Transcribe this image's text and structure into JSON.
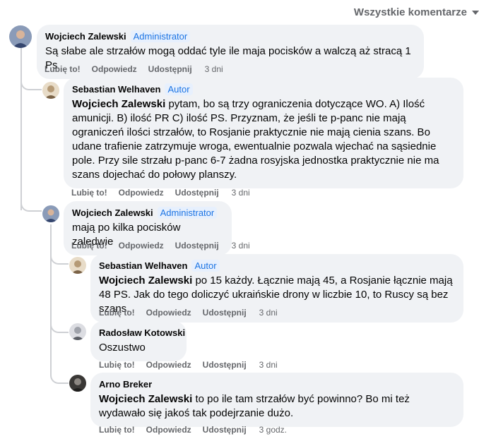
{
  "sort": {
    "label": "Wszystkie komentarze",
    "icon": "caret-down-icon"
  },
  "actions": {
    "like": "Lubię to!",
    "reply": "Odpowiedz",
    "share": "Udostępnij"
  },
  "comments": [
    {
      "author": "Wojciech Zalewski",
      "badge": "Administrator",
      "mention": "",
      "text": "Są słabe ale strzałów mogą oddać tyle ile maja pocisków a walczą aż stracą 1 Ps",
      "time": "3 dni"
    },
    {
      "author": "Sebastian Welhaven",
      "badge": "Autor",
      "mention": "Wojciech Zalewski",
      "text": " pytam, bo są trzy ograniczenia dotyczące WO. A) Ilość amunicji. B) ilość PR C) ilość PS. Przyznam, że jeśli te p-panc nie mają ograniczeń ilości strzałów, to Rosjanie praktycznie nie mają cienia szans. Bo udane trafienie zatrzymuje wroga, ewentualnie pozwala wjechać na sąsiednie pole. Przy sile strzału p-panc 6-7 żadna rosyjska jednostka praktycznie nie ma szans dojechać do połowy planszy.",
      "time": "3 dni"
    },
    {
      "author": "Wojciech Zalewski",
      "badge": "Administrator",
      "mention": "",
      "text": "mają po kilka pocisków zaledwie",
      "time": "3 dni"
    },
    {
      "author": "Sebastian Welhaven",
      "badge": "Autor",
      "mention": "Wojciech Zalewski",
      "text": " po 15 każdy. Łącznie mają 45, a Rosjanie łącznie mają 48 PS. Jak do tego doliczyć ukraińskie drony w liczbie 10, to Ruscy są bez szans.",
      "time": "3 dni"
    },
    {
      "author": "Radosław Kotowski",
      "badge": "",
      "mention": "",
      "text": "Oszustwo",
      "time": "3 dni"
    },
    {
      "author": "Arno Breker",
      "badge": "",
      "mention": "Wojciech Zalewski",
      "text": " to po ile tam strzałów być powinno? Bo mi też wydawało się jakoś tak podejrzanie dużo.",
      "time": "3 godz."
    }
  ]
}
